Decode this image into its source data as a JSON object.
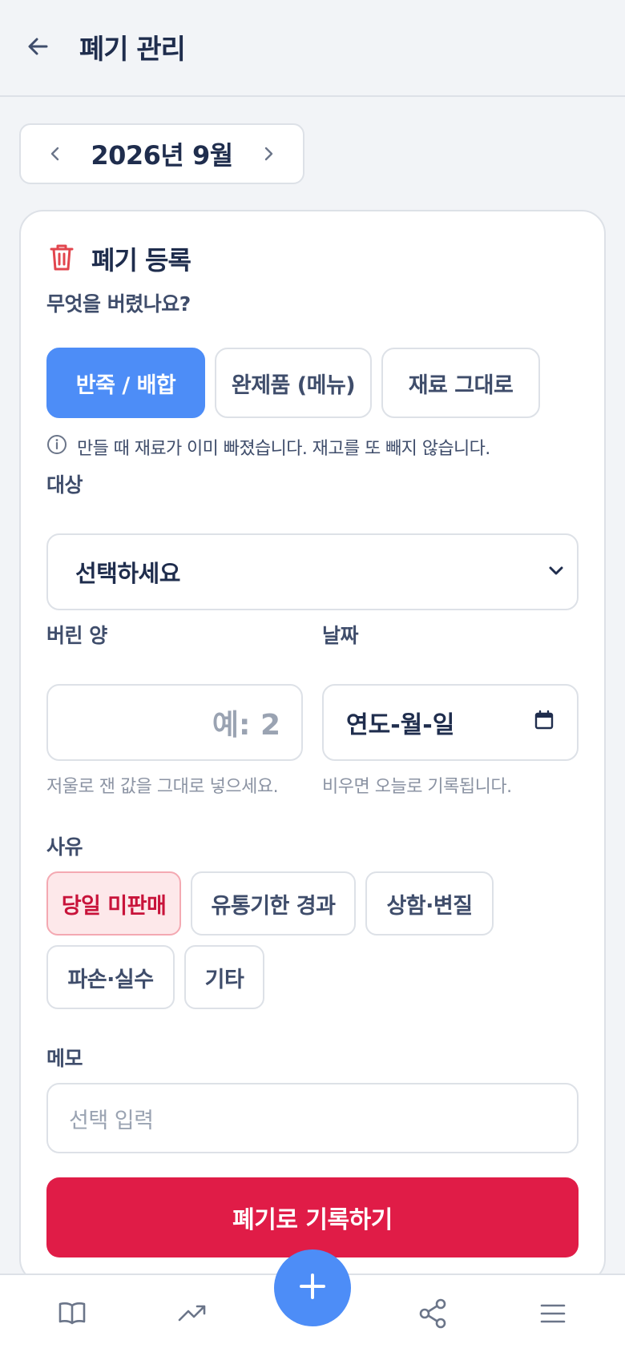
{
  "header": {
    "title": "폐기 관리",
    "back_icon": "arrow-left-icon"
  },
  "month_nav": {
    "label": "2026년 9월"
  },
  "card": {
    "title": "폐기 등록",
    "title_icon": "trash-icon",
    "type_question": "무엇을 버렸나요?",
    "types": [
      {
        "label": "반죽 / 배합",
        "active": true
      },
      {
        "label": "완제품 (메뉴)",
        "active": false
      },
      {
        "label": "재료 그대로",
        "active": false
      }
    ],
    "info_text": "만들 때 재료가 이미 빠졌습니다. 재고를 또 빼지 않습니다.",
    "target_label": "대상",
    "target_value": "선택하세요",
    "qty_label": "버린 양",
    "qty_placeholder": "예: 2",
    "qty_hint": "저울로 잰 값을 그대로 넣으세요.",
    "date_label": "날짜",
    "date_placeholder": "연도-월-일",
    "date_hint": "비우면 오늘로 기록됩니다.",
    "reason_label": "사유",
    "reasons": [
      {
        "label": "당일 미판매",
        "active": true
      },
      {
        "label": "유통기한 경과",
        "active": false
      },
      {
        "label": "상함·변질",
        "active": false
      },
      {
        "label": "파손·실수",
        "active": false
      },
      {
        "label": "기타",
        "active": false
      }
    ],
    "memo_label": "메모",
    "memo_placeholder": "선택 입력",
    "submit_label": "폐기로 기록하기"
  },
  "colors": {
    "accent": "#4d8df7",
    "danger": "#e01c47",
    "danger_bg": "#fde8ea"
  },
  "bottom_nav": [
    "book-icon",
    "trending-up-icon",
    "plus-icon",
    "share-icon",
    "menu-icon"
  ]
}
